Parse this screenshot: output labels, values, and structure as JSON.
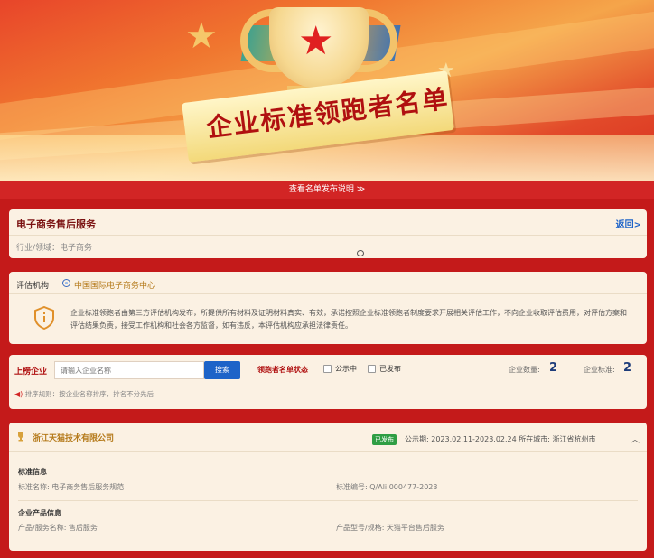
{
  "banner": {
    "title": "企业标准领跑者名单"
  },
  "notice": {
    "label": "查看名单发布说明 ≫"
  },
  "service": {
    "title": "电子商务售后服务",
    "back_label": "返回>",
    "industry_label": "行业/领域：",
    "industry_value": "电子商务"
  },
  "agency": {
    "label": "评估机构",
    "name": "中国国际电子商务中心",
    "disclaimer": "企业标准领跑者由第三方评估机构发布，所提供所有材料及证明材料真实、有效，承诺按照企业标准领跑者制度要求开展相关评估工作，不向企业收取评估费用，对评估方案和评估结果负责，接受工作机构和社会各方监督，如有违反，本评估机构应承担法律责任。"
  },
  "filter": {
    "company_label": "上榜企业",
    "search_placeholder": "请输入企业名称",
    "search_button": "搜索",
    "status_label": "领跑者名单状态",
    "status_options": [
      "公示中",
      "已发布"
    ],
    "company_count_label": "企业数量:",
    "company_count": "2",
    "standard_count_label": "企业标准:",
    "standard_count": "2",
    "sort_rule": "排序规则：按企业名称排序，排名不分先后"
  },
  "company": {
    "name": "浙江天猫技术有限公司",
    "status_badge": "已发布",
    "period": "公示期:  2023.02.11-2023.02.24   所在城市:  浙江省杭州市",
    "standard_section": "标准信息",
    "standard_name_label": "标准名称:  电子商务售后服务规范",
    "standard_no_label": "标准编号:  Q/Ali 000477-2023",
    "product_section": "企业产品信息",
    "product_name_label": "产品/服务名称:  售后服务",
    "product_model_label": "产品型号/规格:  天猫平台售后服务"
  },
  "colors": {
    "primary_red": "#c41a1a",
    "accent_blue": "#1d63c8",
    "badge_green": "#2f9e44",
    "gold": "#b57a1a"
  }
}
